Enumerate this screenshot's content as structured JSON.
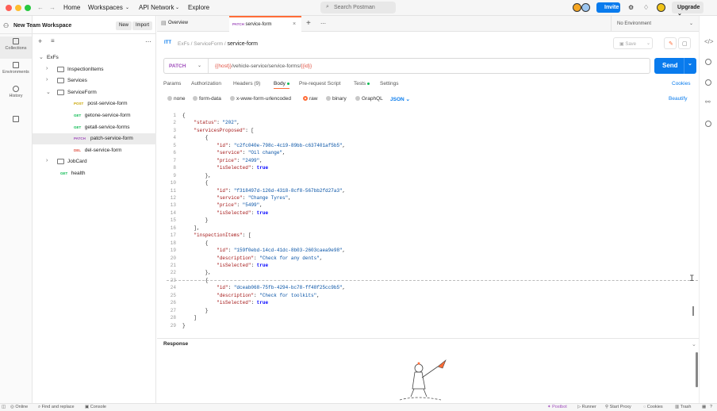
{
  "titlebar": {
    "home": "Home",
    "workspaces": "Workspaces",
    "api_network": "API Network",
    "explore": "Explore",
    "search_placeholder": "Search Postman",
    "invite": "Invite",
    "upgrade": "Upgrade"
  },
  "sidebar": {
    "workspace": "New Team Workspace",
    "new": "New",
    "import": "Import",
    "rail": [
      "Collections",
      "Environments",
      "History"
    ],
    "tree": [
      {
        "label": "ExFs",
        "method": "",
        "type": "collection"
      },
      {
        "label": "InspectionItems",
        "method": "",
        "type": "folder"
      },
      {
        "label": "Services",
        "method": "",
        "type": "folder"
      },
      {
        "label": "ServiceForm",
        "method": "",
        "type": "folder-open"
      },
      {
        "label": "post-service-form",
        "method": "POST",
        "type": "request"
      },
      {
        "label": "getone-service-form",
        "method": "GET",
        "type": "request"
      },
      {
        "label": "getall-service-forms",
        "method": "GET",
        "type": "request"
      },
      {
        "label": "patch-service-form",
        "method": "PATCH",
        "type": "request"
      },
      {
        "label": "del-service-form",
        "method": "DEL",
        "type": "request"
      },
      {
        "label": "JobCard",
        "method": "",
        "type": "folder"
      },
      {
        "label": "health",
        "method": "GET",
        "type": "request"
      }
    ]
  },
  "tabs": [
    {
      "label": "Overview"
    },
    {
      "method": "PATCH",
      "label": "service-form"
    }
  ],
  "environment": "No Environment",
  "breadcrumb": {
    "root": "ExFs",
    "folder": "ServiceForm",
    "current": "service-form"
  },
  "save": "Save",
  "request": {
    "method": "PATCH",
    "url_host": "{{host}}",
    "url_path": "/vehicle-service/service-forms/",
    "url_var": "{{id}}",
    "send": "Send"
  },
  "subtabs": [
    "Params",
    "Authorization",
    "Headers (9)",
    "Body",
    "Pre-request Script",
    "Tests",
    "Settings"
  ],
  "cookies": "Cookies",
  "body_types": [
    "none",
    "form-data",
    "x-www-form-urlencoded",
    "raw",
    "binary",
    "GraphQL"
  ],
  "json_label": "JSON",
  "beautify": "Beautify",
  "code_lines": [
    "{",
    "    \"status\": \"202\",",
    "    \"servicesProposed\": [",
    "        {",
    "            \"id\": \"c2fc040e-798c-4c19-89bb-c637401af5b5\",",
    "            \"service\": \"Oil change\",",
    "            \"price\": \"2499\",",
    "            \"isSelected\": true",
    "        },",
    "        {",
    "            \"id\": \"f318497d-126d-4318-8cf8-567bb2fd27a3\",",
    "            \"service\": \"Change Tyres\",",
    "            \"price\": \"5499\",",
    "            \"isSelected\": true",
    "        }",
    "    ],",
    "    \"inspectionItems\": [",
    "        {",
    "            \"id\": \"159f0ebd-14cd-41dc-8b03-2603caea9e98\",",
    "            \"description\": \"Check for any dents\",",
    "            \"isSelected\": true",
    "        },",
    "        {",
    "            \"id\": \"dceab068-75fb-4294-bc78-ff48f25cc9b5\",",
    "            \"description\": \"Check for toolkits\",",
    "            \"isSelected\": true",
    "        }",
    "    ]",
    "}"
  ],
  "response_label": "Response",
  "statusbar": [
    "Online",
    "Find and replace",
    "Console",
    "Postbot",
    "Runner",
    "Start Proxy",
    "Cookies",
    "Trash"
  ]
}
